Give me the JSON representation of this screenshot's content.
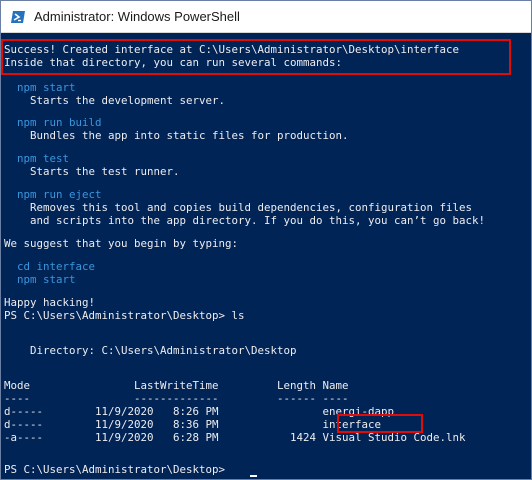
{
  "window": {
    "title": "Administrator: Windows PowerShell",
    "colors": {
      "console_bg": "#012456",
      "console_text": "#eeedf0",
      "command_text": "#3a96dd",
      "highlight_box": "#e00b0b"
    }
  },
  "lines": {
    "success": "Success! Created interface at C:\\Users\\Administrator\\Desktop\\interface",
    "inside": "Inside that directory, you can run several commands:",
    "npm_start_cmd": "  npm start",
    "npm_start_desc": "    Starts the development server.",
    "npm_build_cmd": "  npm run build",
    "npm_build_desc": "    Bundles the app into static files for production.",
    "npm_test_cmd": "  npm test",
    "npm_test_desc": "    Starts the test runner.",
    "npm_eject_cmd": "  npm run eject",
    "npm_eject_desc1": "    Removes this tool and copies build dependencies, configuration files",
    "npm_eject_desc2": "    and scripts into the app directory. If you do this, you can’t go back!",
    "suggest": "We suggest that you begin by typing:",
    "cd_cmd": "  cd interface",
    "start_cmd": "  npm start",
    "happy": "Happy hacking!",
    "prompt_ls": "PS C:\\Users\\Administrator\\Desktop> ls",
    "directory": "    Directory: C:\\Users\\Administrator\\Desktop",
    "header": "Mode                LastWriteTime         Length Name",
    "underline": "----                -------------         ------ ----",
    "row1": "d-----        11/9/2020   8:26 PM                energi-dapp",
    "row2": "d-----        11/9/2020   8:36 PM                interface",
    "row3": "-a----        11/9/2020   6:28 PM           1424 Visual Studio Code.lnk",
    "prompt_final": "PS C:\\Users\\Administrator\\Desktop> "
  }
}
